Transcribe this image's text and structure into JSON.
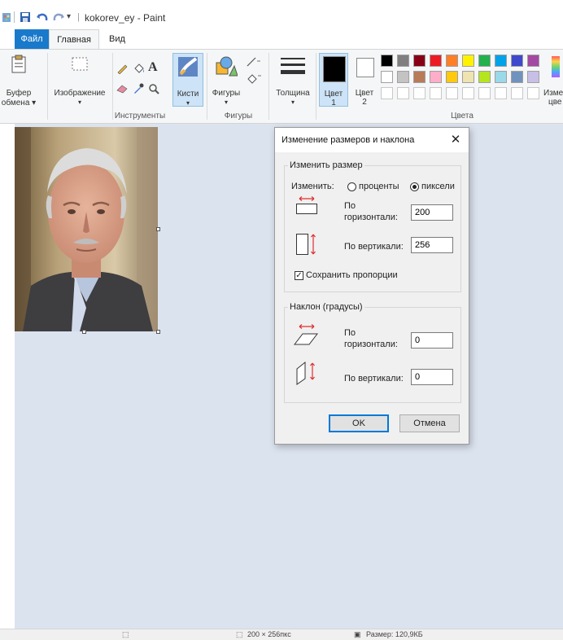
{
  "window": {
    "title": "kokorev_ey - Paint"
  },
  "quick_access": {
    "icons": [
      "paint-app-icon",
      "save-icon",
      "undo-icon",
      "redo-icon",
      "customize-dropdown-icon"
    ]
  },
  "tabs": [
    {
      "label": "Файл"
    },
    {
      "label": "Главная"
    },
    {
      "label": "Вид"
    }
  ],
  "ribbon": {
    "clipboard_label_1": "Буфер",
    "clipboard_label_2": "обмена ▾",
    "image_label": "Изображение",
    "tools_group": "Инструменты",
    "brushes_label": "Кисти",
    "shapes_label": "Фигуры",
    "shapes_group": "Фигуры",
    "thickness_label": "Толщина",
    "color1_label_1": "Цвет",
    "color1_label_2": "1",
    "color2_label_1": "Цвет",
    "color2_label_2": "2",
    "colors_group": "Цвета",
    "edit_colors_label_1": "Изме",
    "edit_colors_label_2": "цве",
    "palette_row1": [
      "#000000",
      "#7f7f7f",
      "#880015",
      "#ed1c24",
      "#ff7f27",
      "#fff200",
      "#22b14c",
      "#00a2e8",
      "#3f48cc",
      "#a349a4"
    ],
    "palette_row2": [
      "#ffffff",
      "#c3c3c3",
      "#b97a57",
      "#ffaec9",
      "#ffc90e",
      "#efe4b0",
      "#b5e61d",
      "#99d9ea",
      "#7092be",
      "#c8bfe7"
    ]
  },
  "status": {
    "size_text": "200 × 256пкс",
    "file_size_text": "Размер: 120,9КБ"
  },
  "dialog": {
    "title": "Изменение размеров и наклона",
    "resize_group": "Изменить размер",
    "by_label": "Изменить:",
    "percent_label": "проценты",
    "pixels_label": "пиксели",
    "selected_unit": "пиксели",
    "horiz_label_1": "По",
    "horiz_label_2": "горизонтали:",
    "horiz_value": "200",
    "vert_label": "По вертикали:",
    "vert_value": "256",
    "keep_ratio_label": "Сохранить пропорции",
    "keep_ratio_checked": true,
    "skew_group": "Наклон (градусы)",
    "skew_horiz_label_1": "По",
    "skew_horiz_label_2": "горизонтали:",
    "skew_horiz_value": "0",
    "skew_vert_label": "По вертикали:",
    "skew_vert_value": "0",
    "ok_label": "OK",
    "cancel_label": "Отмена"
  },
  "colors": {
    "accent": "#1979ca",
    "canvas_bg": "#dbe3ef",
    "ribbon_bg": "#f5f6f7",
    "arrow_red": "#e03030"
  }
}
